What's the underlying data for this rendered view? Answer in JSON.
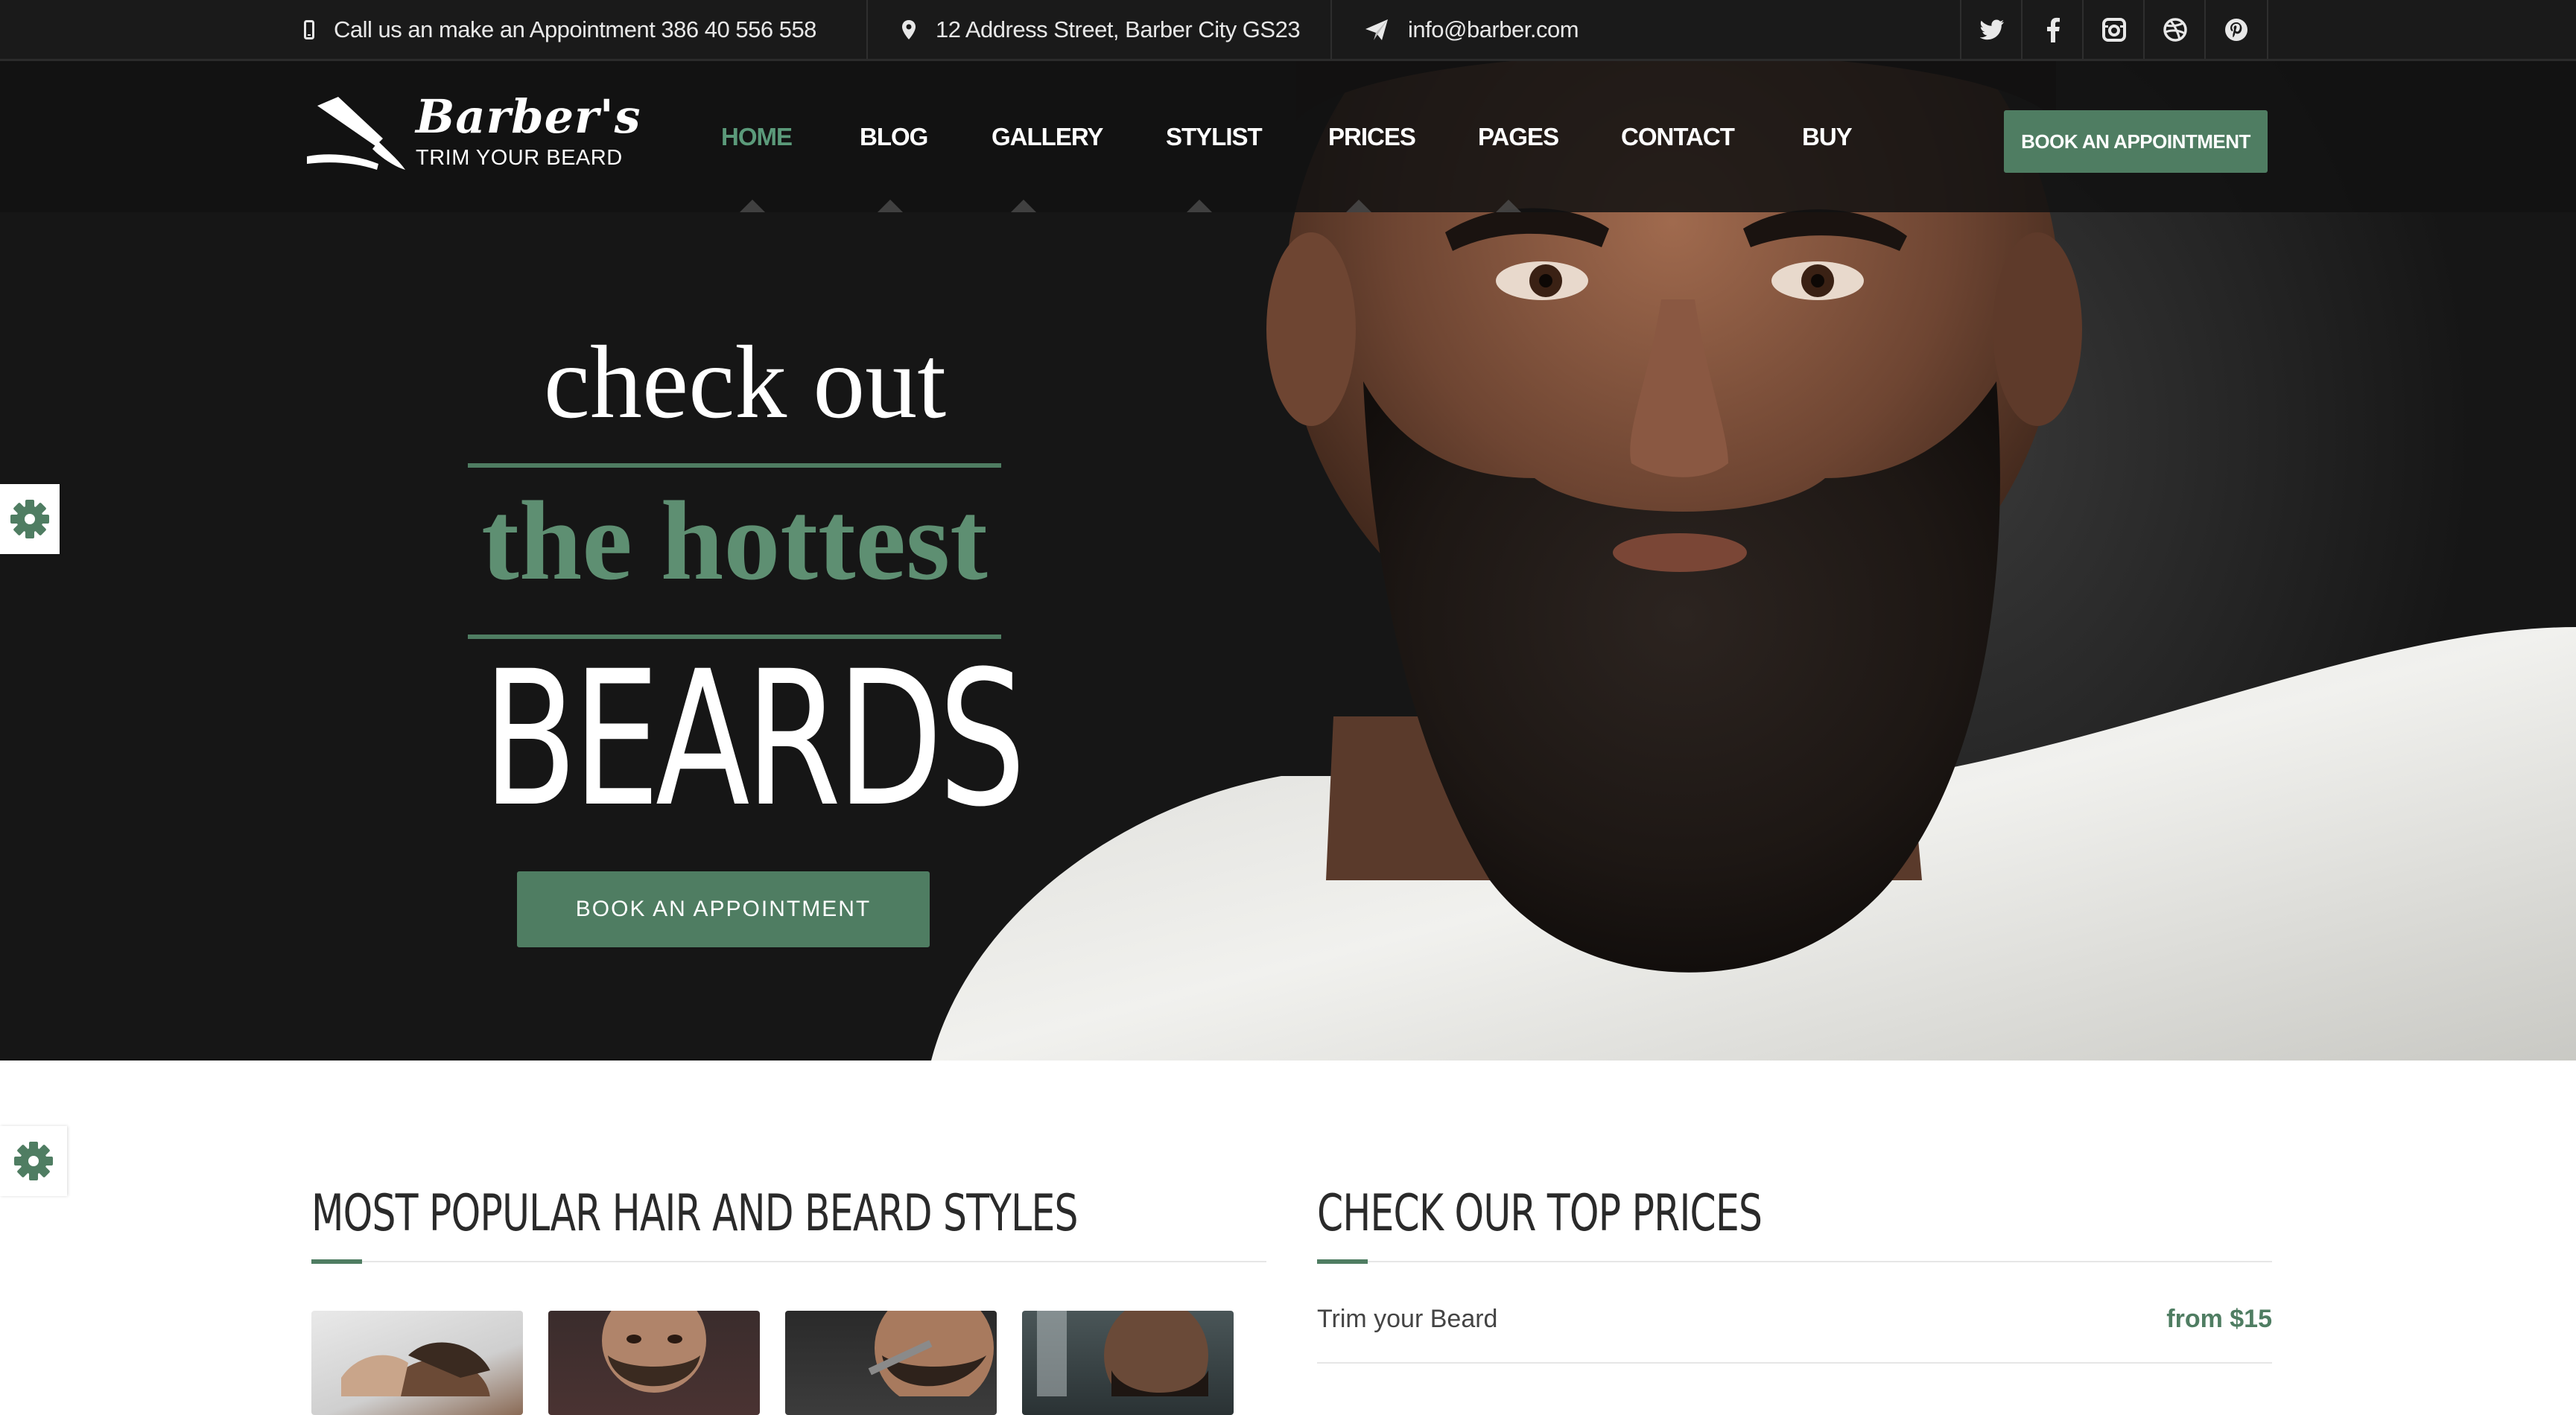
{
  "topbar": {
    "phone": "Call us an make an Appointment 386 40 556 558",
    "address": "12 Address Street, Barber City GS23",
    "email": "info@barber.com",
    "social": [
      "twitter-icon",
      "facebook-icon",
      "instagram-icon",
      "dribbble-icon",
      "pinterest-icon"
    ]
  },
  "logo": {
    "title": "Barber's",
    "subtitle": "TRIM YOUR BEARD"
  },
  "nav": {
    "items": [
      "HOME",
      "BLOG",
      "GALLERY",
      "STYLIST",
      "PRICES",
      "PAGES",
      "CONTACT",
      "BUY"
    ],
    "active": "HOME",
    "cta": "BOOK AN APPOINTMENT"
  },
  "hero": {
    "line1": "check out",
    "line2": "the hottest",
    "line3": "BEARDS",
    "button": "BOOK AN APPOINTMENT"
  },
  "styles_section": {
    "title": "MOST POPULAR HAIR AND BEARD STYLES"
  },
  "prices_section": {
    "title": "CHECK OUR TOP PRICES",
    "items": [
      {
        "name": "Trim your Beard",
        "price": "from $15"
      }
    ]
  },
  "colors": {
    "accent": "#4f7d62",
    "accent_text": "#5e8f72",
    "topbar": "#1a1a1a"
  }
}
